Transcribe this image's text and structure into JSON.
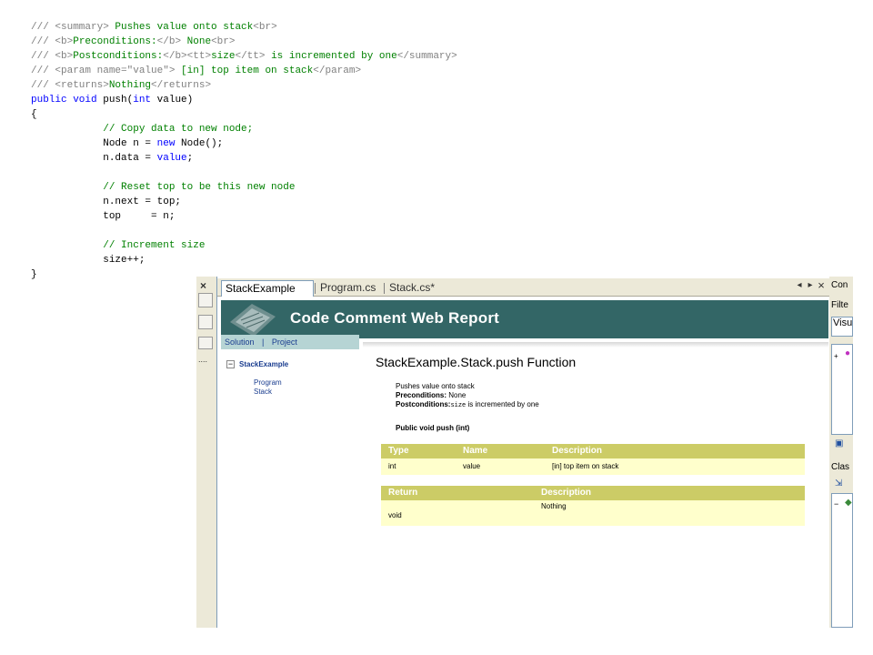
{
  "code": {
    "lines": [
      [
        {
          "t": "/// ",
          "c": "gray"
        },
        {
          "t": "<summary>",
          "c": "gray"
        },
        {
          "t": " Pushes value onto stack",
          "c": "green"
        },
        {
          "t": "<br>",
          "c": "gray"
        }
      ],
      [
        {
          "t": "/// ",
          "c": "gray"
        },
        {
          "t": "<b>",
          "c": "gray"
        },
        {
          "t": "Preconditions:",
          "c": "green"
        },
        {
          "t": "</b>",
          "c": "gray"
        },
        {
          "t": " None",
          "c": "green"
        },
        {
          "t": "<br>",
          "c": "gray"
        }
      ],
      [
        {
          "t": "/// ",
          "c": "gray"
        },
        {
          "t": "<b>",
          "c": "gray"
        },
        {
          "t": "Postconditions:",
          "c": "green"
        },
        {
          "t": "</b><tt>",
          "c": "gray"
        },
        {
          "t": "size",
          "c": "green"
        },
        {
          "t": "</tt>",
          "c": "gray"
        },
        {
          "t": " is incremented by one",
          "c": "green"
        },
        {
          "t": "</summary>",
          "c": "gray"
        }
      ],
      [
        {
          "t": "/// ",
          "c": "gray"
        },
        {
          "t": "<param name=\"value\">",
          "c": "gray"
        },
        {
          "t": " [in] top item on stack",
          "c": "green"
        },
        {
          "t": "</param>",
          "c": "gray"
        }
      ],
      [
        {
          "t": "/// ",
          "c": "gray"
        },
        {
          "t": "<returns>",
          "c": "gray"
        },
        {
          "t": "Nothing",
          "c": "green"
        },
        {
          "t": "</returns>",
          "c": "gray"
        }
      ],
      [
        {
          "t": "public void",
          "c": "blue"
        },
        {
          "t": " push(",
          "c": "black"
        },
        {
          "t": "int",
          "c": "blue"
        },
        {
          "t": " value)",
          "c": "black"
        }
      ],
      [
        {
          "t": "{",
          "c": "black"
        }
      ],
      [
        {
          "t": "            // Copy data to new node;",
          "c": "green"
        }
      ],
      [
        {
          "t": "            Node n = ",
          "c": "black"
        },
        {
          "t": "new",
          "c": "blue"
        },
        {
          "t": " Node();",
          "c": "black"
        }
      ],
      [
        {
          "t": "            n.data = ",
          "c": "black"
        },
        {
          "t": "value",
          "c": "blue"
        },
        {
          "t": ";",
          "c": "black"
        }
      ],
      [
        {
          "t": "",
          "c": "black"
        }
      ],
      [
        {
          "t": "            // Reset top to be this new node",
          "c": "green"
        }
      ],
      [
        {
          "t": "            n.next = top;",
          "c": "black"
        }
      ],
      [
        {
          "t": "            top     = n;",
          "c": "black"
        }
      ],
      [
        {
          "t": "",
          "c": "black"
        }
      ],
      [
        {
          "t": "            // Increment size",
          "c": "green"
        }
      ],
      [
        {
          "t": "            size++;",
          "c": "black"
        }
      ],
      [
        {
          "t": "}",
          "c": "black"
        }
      ]
    ]
  },
  "tabs": [
    {
      "label": "StackExample"
    },
    {
      "label": "Program.cs"
    },
    {
      "label": "Stack.cs*"
    }
  ],
  "tab_controls": {
    "left": "◂",
    "right": "▸",
    "close": "×"
  },
  "strip": {
    "close": "×",
    "dots": "...."
  },
  "banner": {
    "title": "Code Comment Web Report"
  },
  "nav": {
    "solution": "Solution",
    "separator": "|",
    "project": "Project",
    "expander": "−",
    "root": "StackExample",
    "items": [
      "Program",
      "Stack"
    ]
  },
  "report": {
    "title": "StackExample.Stack.push Function",
    "summary": "Pushes value onto stack",
    "pre_label": "Preconditions:",
    "pre_value": " None",
    "post_label": "Postconditions:",
    "post_code": "size",
    "post_value": " is incremented by one",
    "signature": "Public void push (int)",
    "params_table": {
      "headers": [
        "Type",
        "Name",
        "Description"
      ],
      "rows": [
        [
          "int",
          "value",
          "[in] top item on stack"
        ]
      ]
    },
    "returns_table": {
      "headers": [
        "Return",
        "Description"
      ],
      "rows": [
        [
          "void",
          "Nothing"
        ]
      ]
    }
  },
  "right_panel": {
    "labels": [
      "Con",
      "Filte",
      "Visu",
      "Clas"
    ],
    "expander": "+",
    "expander2": "−"
  }
}
